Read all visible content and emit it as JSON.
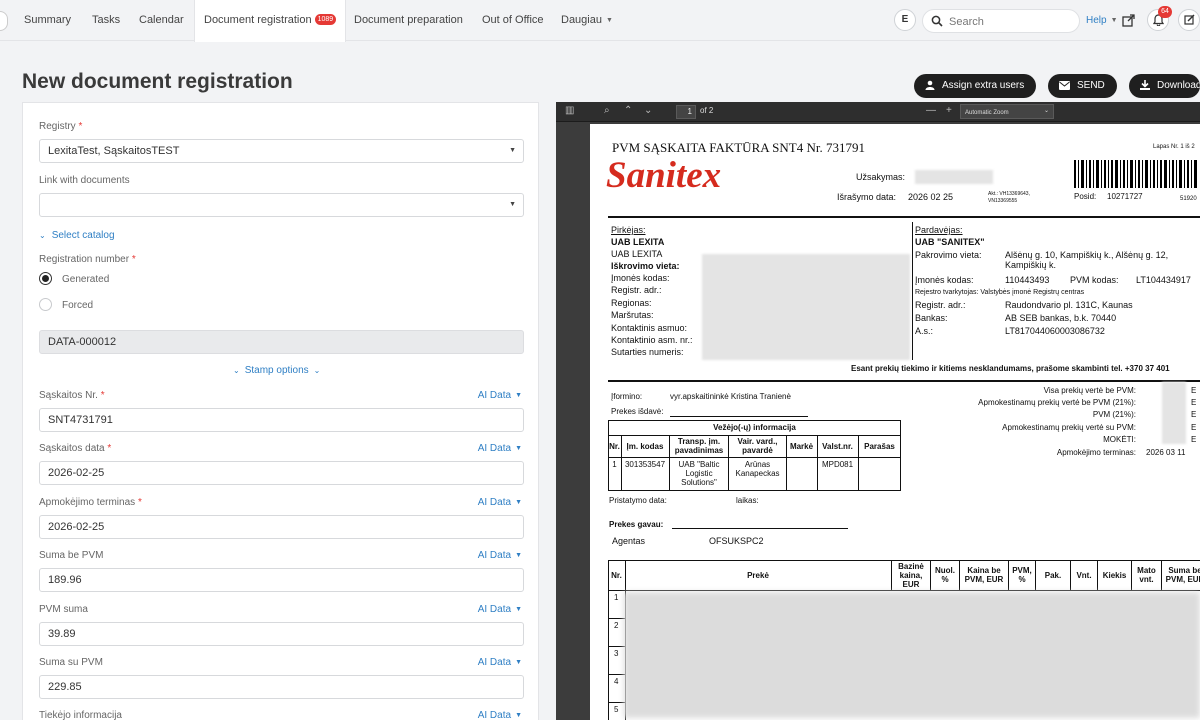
{
  "nav": {
    "tabs": [
      {
        "label": "Summary"
      },
      {
        "label": "Tasks"
      },
      {
        "label": "Calendar"
      },
      {
        "label": "Document registration",
        "badge": "1089"
      },
      {
        "label": "Document preparation"
      },
      {
        "label": "Out of Office"
      },
      {
        "label": "Daugiau"
      }
    ],
    "user_initial": "E",
    "search_placeholder": "Search",
    "help_label": "Help",
    "notification_count": "64"
  },
  "page": {
    "title": "New document registration"
  },
  "actions": {
    "assign_label": "Assign extra users",
    "send_label": "SEND",
    "download_label": "Download"
  },
  "form": {
    "registry": {
      "label": "Registry",
      "required": "*",
      "value": "LexitaTest, SąskaitosTEST"
    },
    "link_docs": {
      "label": "Link with documents",
      "value": ""
    },
    "select_catalog_label": "Select catalog",
    "reg_number": {
      "label": "Registration number",
      "required": "*",
      "option_generated": "Generated",
      "option_forced": "Forced",
      "value": "DATA-000012"
    },
    "stamp_options_label": "Stamp options",
    "ai_label": "AI Data",
    "fields": [
      {
        "label": "Sąskaitos Nr.",
        "required": "*",
        "value": "SNT4731791"
      },
      {
        "label": "Sąskaitos data",
        "required": "*",
        "value": "2026-02-25"
      },
      {
        "label": "Apmokėjimo terminas",
        "required": "*",
        "value": "2026-02-25"
      },
      {
        "label": "Suma be PVM",
        "required": "",
        "value": "189.96"
      },
      {
        "label": "PVM suma",
        "required": "",
        "value": "39.89"
      },
      {
        "label": "Suma su PVM",
        "required": "",
        "value": "229.85"
      },
      {
        "label": "Tiekėjo informacija",
        "required": "",
        "value": ""
      }
    ]
  },
  "viewer": {
    "page_number": "1",
    "page_total": "of 2",
    "zoom": "Automatic Zoom"
  },
  "invoice": {
    "heading": "PVM SĄSKAITA FAKTŪRA  SNT4 Nr.  731791",
    "logo": "Sanitex",
    "page_info": "Lapas Nr. 1 iš 2",
    "uzsakymas": "Užsakymas:",
    "israsymo": "Išrašymo data:",
    "israsymo_date": "2026 02 25",
    "akt": "Akt.: VH13369643,",
    "akt2": "VN13369555",
    "posid": "Posid:",
    "posid_val": "10271727",
    "barcode_num": "51920",
    "buyer": {
      "title": "Pirkėjas:",
      "name1": "UAB LEXITA",
      "name2": "UAB LEXITA",
      "iskrovimo": "Iškrovimo vieta:",
      "kodas": "Įmonės kodas:",
      "adr": "Registr. adr.:",
      "regionas": "Regionas:",
      "marsrutas": "Maršrutas:",
      "kontaktinis": "Kontaktinis asmuo:",
      "kontaktinio_nr": "Kontaktinio asm. nr.:",
      "sutarties": "Sutarties numeris:"
    },
    "seller": {
      "title": "Pardavėjas:",
      "name": "UAB \"SANITEX\"",
      "pakrovimo": "Pakrovimo vieta:",
      "pakrovimo_val": "Alšėnų g. 10, Kampiškių k., Alšėnų g. 12,",
      "pakrovimo_val2": "Kampiškių k.",
      "kodas": "Įmonės kodas:",
      "kodas_val": "110443493",
      "pvm_kodas": "PVM kodas:",
      "pvm_val": "LT104434917",
      "tvarkytojas": "Rejestro tvarkytojas: Valstybės įmonė Registrų centras",
      "adr": "Registr. adr.:",
      "adr_val": "Raudondvario pl. 131C, Kaunas",
      "bankas": "Bankas:",
      "bankas_val": "AB SEB bankas, b.k. 70440",
      "as": "A.s.:",
      "as_val": "LT817044060003086732"
    },
    "notice": "Esant prekių tiekimo ir kitiems nesklandumams, prašome skambinti tel. +370 37 401",
    "iformino": "Įformino:",
    "iformino_val": "vyr.apskaitininkė Kristina Tranienė",
    "prekes_isdave": "Prekes išdavė:",
    "vezejo_title": "Vežėjo(-ų) informacija",
    "vezejo_headers": [
      "Nr.",
      "Įm. kodas",
      "Transp. įm. pavadinimas",
      "Vair. vard., pavardė",
      "Markė",
      "Valst.nr.",
      "Parašas"
    ],
    "vezejo_row": [
      "1",
      "301353547",
      "UAB \"Baltic Logistic Solutions\"",
      "Arūnas Kanapeckas",
      "",
      "MPD081",
      ""
    ],
    "totals": [
      "Visa prekių vertė be PVM:",
      "Apmokestinamų prekių vertė be PVM (21%):",
      "PVM (21%):",
      "Apmokestinamų prekių vertė su PVM:",
      "MOKĖTI:",
      "Apmokėjimo terminas:"
    ],
    "totals_currency": "E",
    "apmokejimo_val": "2026 03 11",
    "pristatymo": "Pristatymo data:",
    "laikas": "laikas:",
    "prekes_gavau": "Prekes gavau:",
    "agentas": "Agentas",
    "agentas_val": "OFSUKSPC2",
    "items_headers": [
      "Nr.",
      "Prekė",
      "Bazinė kaina, EUR",
      "Nuol. %",
      "Kaina be PVM, EUR",
      "PVM, %",
      "Pak.",
      "Vnt.",
      "Kiekis",
      "Mato vnt.",
      "Suma be PVM, EUR"
    ],
    "row_numbers": [
      "1",
      "2",
      "3",
      "4",
      "5"
    ]
  },
  "colors": {
    "accent": "#2f7fc4",
    "danger": "#e53935",
    "dark_button": "#1f1f1f",
    "logo_red": "#d52b1e"
  }
}
